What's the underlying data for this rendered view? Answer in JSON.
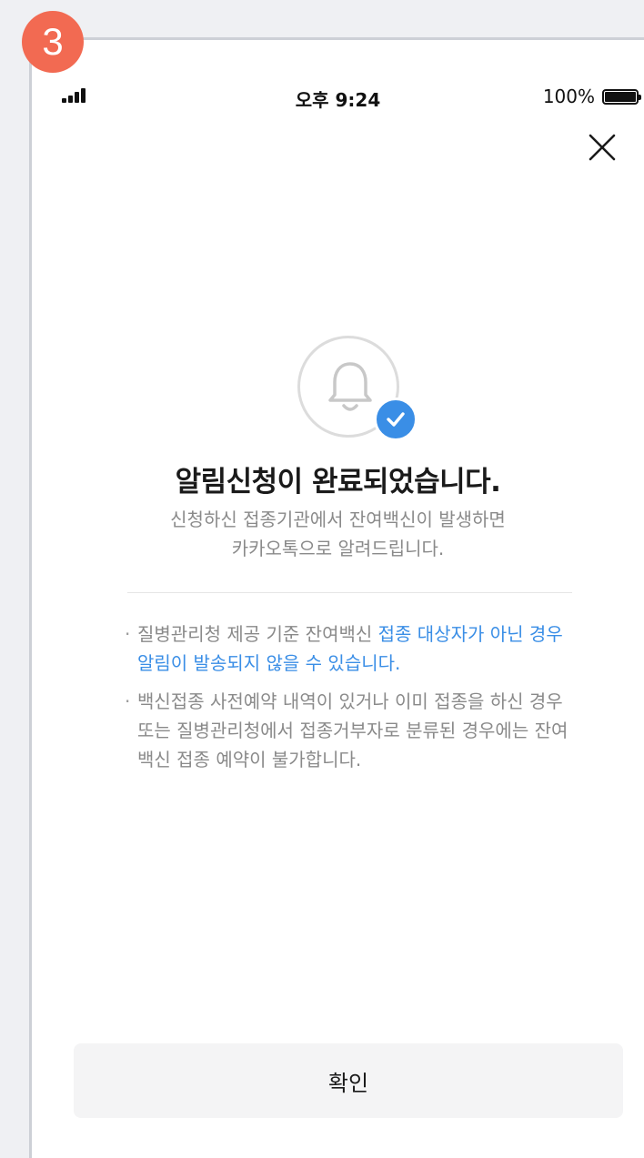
{
  "step": {
    "number": "3"
  },
  "status_bar": {
    "time": "오후 9:24",
    "battery": "100%"
  },
  "icons": {
    "close": "close-icon",
    "bell": "bell-icon",
    "check": "check-icon",
    "signal": "signal-icon",
    "battery": "battery-icon"
  },
  "colors": {
    "accent": "#3a8ee6",
    "step_badge": "#f26a52",
    "button_bg": "#f4f4f5"
  },
  "message": {
    "title": "알림신청이 완료되었습니다.",
    "subtitle_line1": "신청하신 접종기관에서 잔여백신이 발생하면",
    "subtitle_line2": "카카오톡으로 알려드립니다."
  },
  "notes": [
    {
      "text": "질병관리청 제공 기준 잔여백신 ",
      "highlight": "접종 대상자가 아닌 경우 알림이 발송되지 않을 수 있습니다."
    },
    {
      "text": "백신접종 사전예약 내역이 있거나 이미 접종을 하신 경우 또는 질병관리청에서 접종거부자로 분류된 경우에는 잔여백신 접종 예약이 불가합니다."
    }
  ],
  "confirm_button": {
    "label": "확인"
  }
}
